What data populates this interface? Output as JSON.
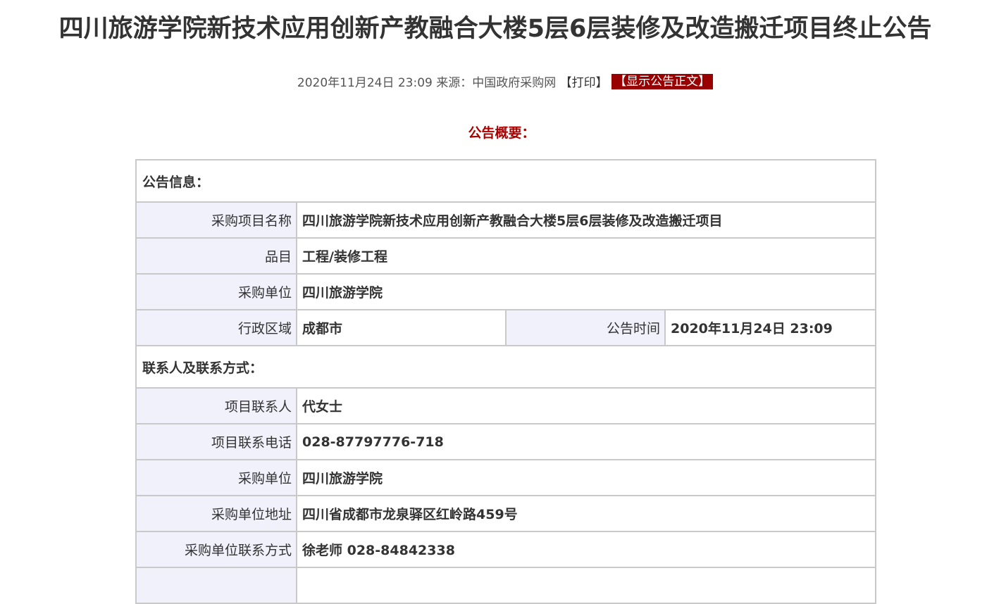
{
  "title": "四川旅游学院新技术应用创新产教融合大楼5层6层装修及改造搬迁项目终止公告",
  "meta": {
    "datetime": "2020年11月24日 23:09",
    "source": "来源：中国政府采购网",
    "print": "【打印】",
    "show_text": "【显示公告正文】"
  },
  "summary_heading": "公告概要：",
  "info_section": {
    "heading": "公告信息：",
    "project_name_label": "采购项目名称",
    "project_name": "四川旅游学院新技术应用创新产教融合大楼5层6层装修及改造搬迁项目",
    "category_label": "品目",
    "category": "工程/装修工程",
    "buyer_label": "采购单位",
    "buyer": "四川旅游学院",
    "region_label": "行政区域",
    "region": "成都市",
    "time_label": "公告时间",
    "time": "2020年11月24日 23:09"
  },
  "contact_section": {
    "heading": "联系人及联系方式：",
    "contact_label": "项目联系人",
    "contact": "代女士",
    "phone_label": "项目联系电话",
    "phone": "028-87797776-718",
    "buyer_label": "采购单位",
    "buyer": "四川旅游学院",
    "address_label": "采购单位地址",
    "address": "四川省成都市龙泉驿区红岭路459号",
    "buyer_contact_label": "采购单位联系方式",
    "buyer_contact": "徐老师 028-84842338"
  },
  "colors": {
    "accent_red": "#990000",
    "heading_red": "#aa0000",
    "label_bg": "#f0f1fb",
    "border": "#c9c9c9"
  }
}
